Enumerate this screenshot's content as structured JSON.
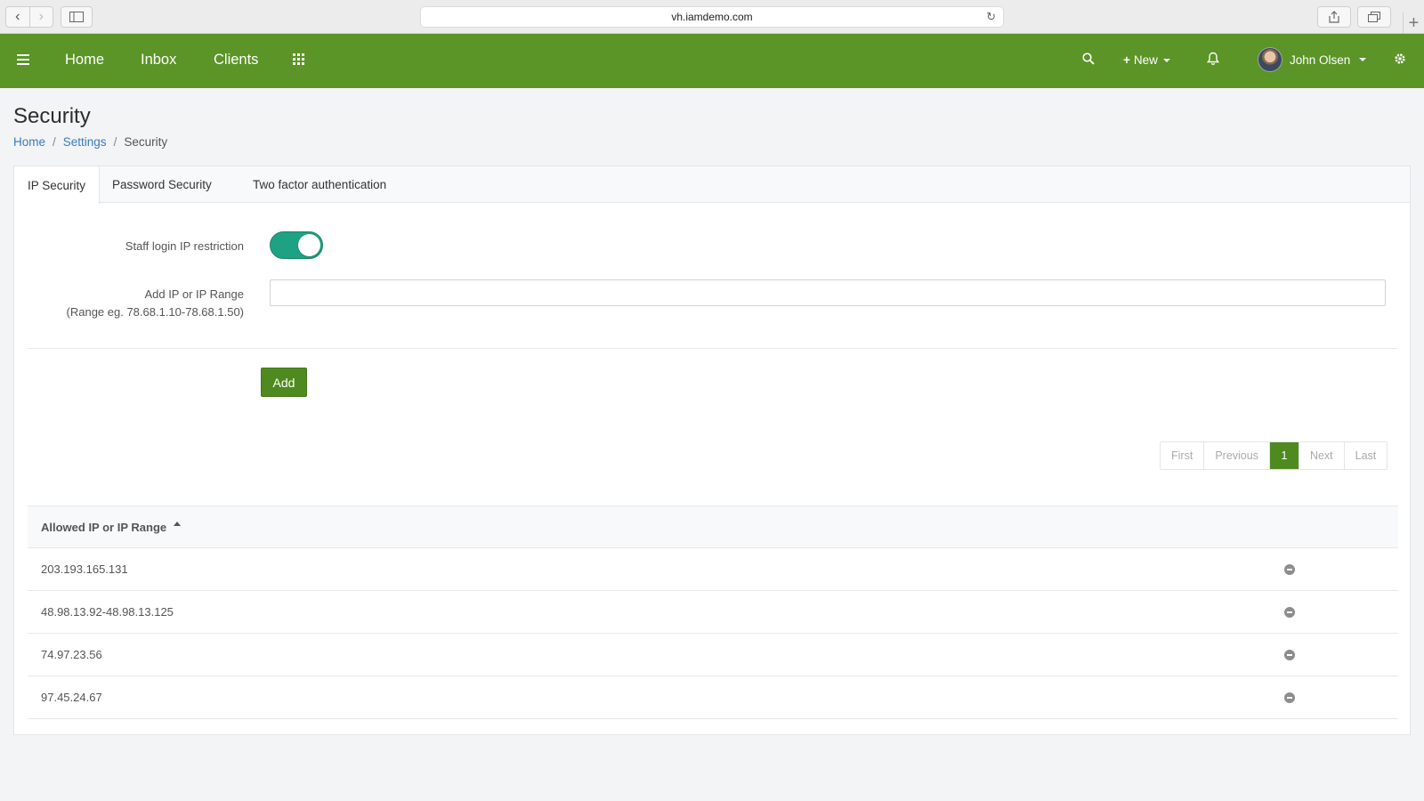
{
  "browser": {
    "url": "vh.iamdemo.com"
  },
  "header": {
    "nav": [
      {
        "label": "Home"
      },
      {
        "label": "Inbox"
      },
      {
        "label": "Clients"
      }
    ],
    "new_label": "New",
    "user_name": "John Olsen",
    "brand_color": "#5b9427"
  },
  "page": {
    "title": "Security",
    "breadcrumb": [
      {
        "label": "Home"
      },
      {
        "label": "Settings"
      },
      {
        "label": "Security"
      }
    ]
  },
  "tabs": [
    {
      "label": "IP Security",
      "active": true
    },
    {
      "label": "Password Security"
    },
    {
      "label": "Two factor authentication"
    }
  ],
  "form": {
    "restriction_label": "Staff login IP restriction",
    "restriction_enabled": true,
    "toggle_color": "#1fa283",
    "ip_label": "Add IP or IP Range",
    "ip_hint": "(Range eg. 78.68.1.10-78.68.1.50)",
    "ip_value": "",
    "add_label": "Add"
  },
  "pagination": {
    "first": "First",
    "previous": "Previous",
    "current": "1",
    "next": "Next",
    "last": "Last"
  },
  "table": {
    "header": "Allowed IP or IP Range",
    "rows": [
      {
        "ip": "203.193.165.131"
      },
      {
        "ip": "48.98.13.92-48.98.13.125"
      },
      {
        "ip": "74.97.23.56"
      },
      {
        "ip": "97.45.24.67"
      }
    ]
  }
}
